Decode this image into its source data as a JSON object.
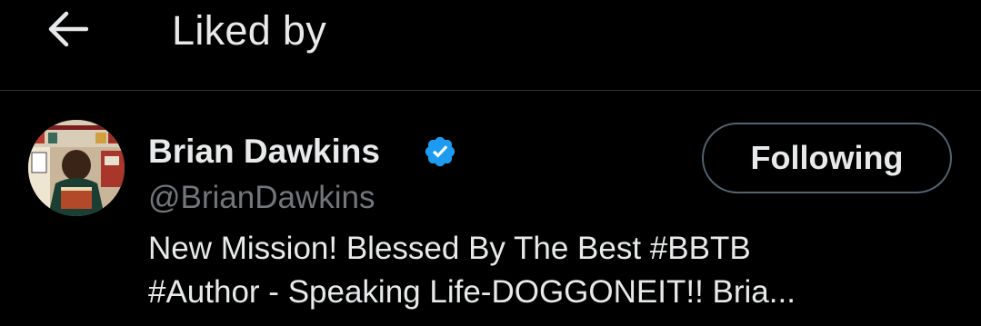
{
  "header": {
    "back_icon": "arrow-left-icon",
    "title": "Liked by"
  },
  "user": {
    "name": "Brian Dawkins",
    "verified_icon": "verified-badge-icon",
    "handle": "@BrianDawkins",
    "bio_line_1": "New Mission! Blessed By The Best #BBTB",
    "bio_line_2": "#Author - Speaking Life-DOGGONEIT!! Bria...",
    "follow_label": "Following"
  },
  "colors": {
    "background": "#000000",
    "text_primary": "#e7e9ea",
    "text_secondary": "#71767b",
    "verified": "#1d9bf0",
    "border": "#2f3336"
  }
}
